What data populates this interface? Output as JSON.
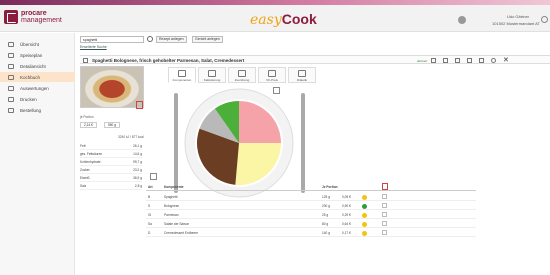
{
  "header": {
    "brand_line1": "procare",
    "brand_line2": "management",
    "app_title_easy": "easy",
    "app_title_cook": "Cook",
    "user_name": "Udo Gärtner",
    "account": "101502 Mustermandant AT",
    "icons": [
      "gear-icon",
      "logout-icon"
    ]
  },
  "sidebar": {
    "items": [
      {
        "label": "Übersicht",
        "icon": "home-icon"
      },
      {
        "label": "Speiseplan",
        "icon": "calendar-icon"
      },
      {
        "label": "Detailansicht",
        "icon": "detail-icon"
      },
      {
        "label": "Kochbuch",
        "icon": "book-icon",
        "active": true
      },
      {
        "label": "Auswertungen",
        "icon": "chart-icon"
      },
      {
        "label": "Drucken",
        "icon": "print-icon"
      },
      {
        "label": "Bestellung",
        "icon": "order-icon"
      }
    ]
  },
  "search": {
    "value": "spaghetti",
    "btn_recipe": "Rezept anlegen",
    "btn_dish": "Gericht anlegen",
    "advanced": "Erweiterte Suche"
  },
  "recipe": {
    "title": "Spaghetti Bolognese, frisch gehobelter Parmesan, Salat, Cremedessert",
    "status": "aktiviert"
  },
  "tabs": [
    {
      "label": "Komponenten",
      "icon": "components-icon"
    },
    {
      "label": "Kalkulierung",
      "icon": "calc-icon"
    },
    {
      "label": "Zuordnung",
      "icon": "assign-icon"
    },
    {
      "label": "VK-Preis",
      "icon": "price-icon"
    },
    {
      "label": "Diätetik",
      "icon": "diet-icon"
    }
  ],
  "nutrition": {
    "portion_label": "je Portion",
    "portion_amount": "2,14 €",
    "portion_weight": "550 g",
    "energy": "3240 kJ / 877 kcal",
    "rows": [
      {
        "k": "Fett",
        "v": "26,1 g"
      },
      {
        "k": "ges. Fettsäuren",
        "v": "14,6 g"
      },
      {
        "k": "Kohlenhydrate",
        "v": "99,7 g"
      },
      {
        "k": "Zucker",
        "v": "23,2 g"
      },
      {
        "k": "Eiweiß",
        "v": "36,9 g"
      },
      {
        "k": "Salz",
        "v": "2,8 g"
      }
    ]
  },
  "table": {
    "headers": [
      "Art",
      "Komponente",
      "Je Portion"
    ],
    "rows": [
      {
        "art": "B",
        "name": "Spaghetti",
        "amount": "125 g",
        "price": "0,09 €",
        "color": "#f1c40f"
      },
      {
        "art": "S",
        "name": "Bolognese",
        "amount": "200 g",
        "price": "0,90 €",
        "color": "#2e9b3f"
      },
      {
        "art": "Gl",
        "name": "Parmesan",
        "amount": "25 g",
        "price": "0,29 €",
        "color": "#f1c40f"
      },
      {
        "art": "Sa",
        "name": "Salate der Saison",
        "amount": "80 g",
        "price": "0,64 €",
        "color": "#f1c40f"
      },
      {
        "art": "D",
        "name": "Cremedessert Erdbeere",
        "amount": "140 g",
        "price": "0,17 €",
        "color": "#f1c40f"
      }
    ]
  },
  "plate_chart": {
    "segments": [
      {
        "color": "#f5a3a8"
      },
      {
        "color": "#fbf5a6"
      },
      {
        "color": "#6b3d22"
      },
      {
        "color": "#b9b9b9"
      },
      {
        "color": "#4caf3a"
      }
    ]
  }
}
